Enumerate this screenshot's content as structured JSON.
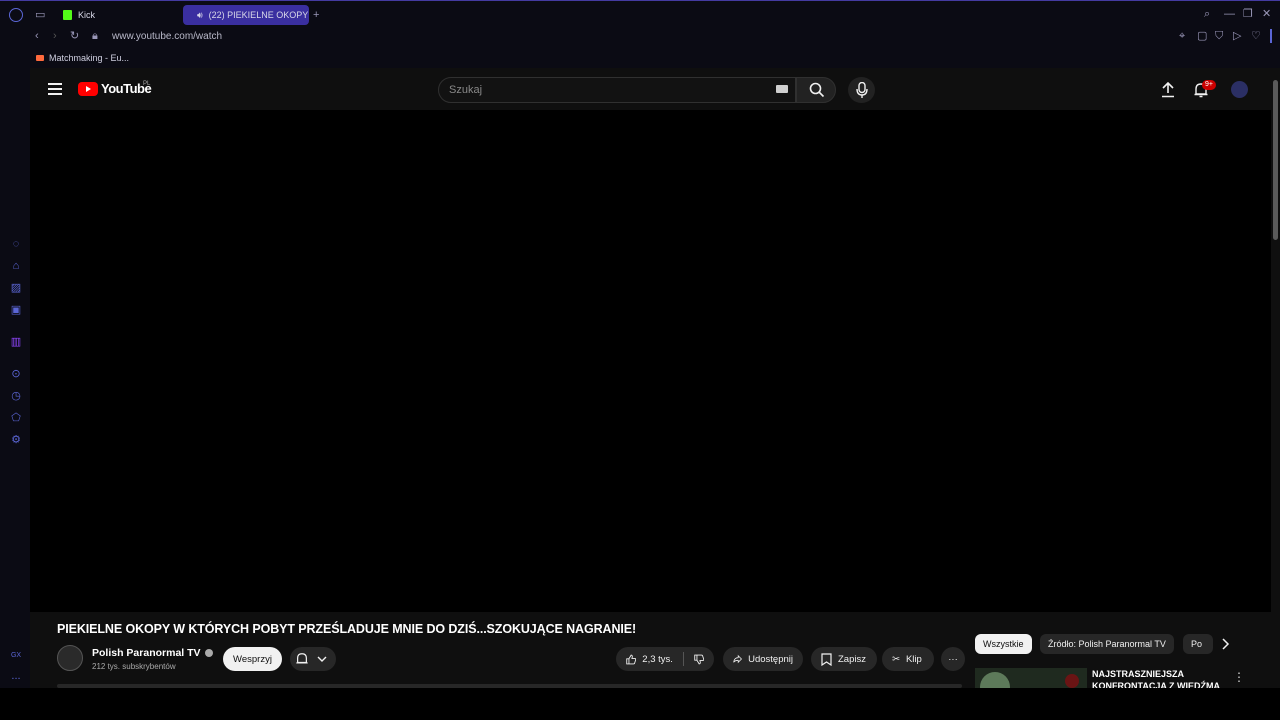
{
  "browser": {
    "tabs": [
      {
        "label": "Kick"
      },
      {
        "label": "(22) PIEKIELNE OKOPY"
      }
    ],
    "new_tab": "+",
    "url": "www.youtube.com/watch",
    "bookmarks": [
      {
        "label": "Matchmaking - Eu..."
      }
    ],
    "sidebar_bottom_label": "GX",
    "sidebar_more": "..."
  },
  "youtube": {
    "logo_text": "YouTube",
    "region": "PL",
    "search_placeholder": "Szukaj",
    "notification_count": "9+"
  },
  "video": {
    "title": "PIEKIELNE OKOPY W KTÓRYCH POBYT PRZEŚLADUJE MNIE DO DZIŚ...SZOKUJĄCE NAGRANIE!",
    "channel_name": "Polish Paranormal TV",
    "subscribers": "212 tys. subskrybentów",
    "support_label": "Wesprzyj",
    "likes": "2,3 tys.",
    "share_label": "Udostępnij",
    "save_label": "Zapisz",
    "clip_label": "Klip",
    "more_label": "···"
  },
  "sidebar_recs": {
    "chips": [
      {
        "label": "Wszystkie"
      },
      {
        "label": "Źródło: Polish Paranormal TV"
      },
      {
        "label": "Po"
      }
    ],
    "first_title": "NAJSTRASZNIEJSZA KONFRONTACJA Z WIEDŹMĄ"
  },
  "colors": {
    "accent_tab": "#3a2fa0",
    "youtube_red": "#ff0000",
    "opera_icon": "#5b66d6"
  }
}
